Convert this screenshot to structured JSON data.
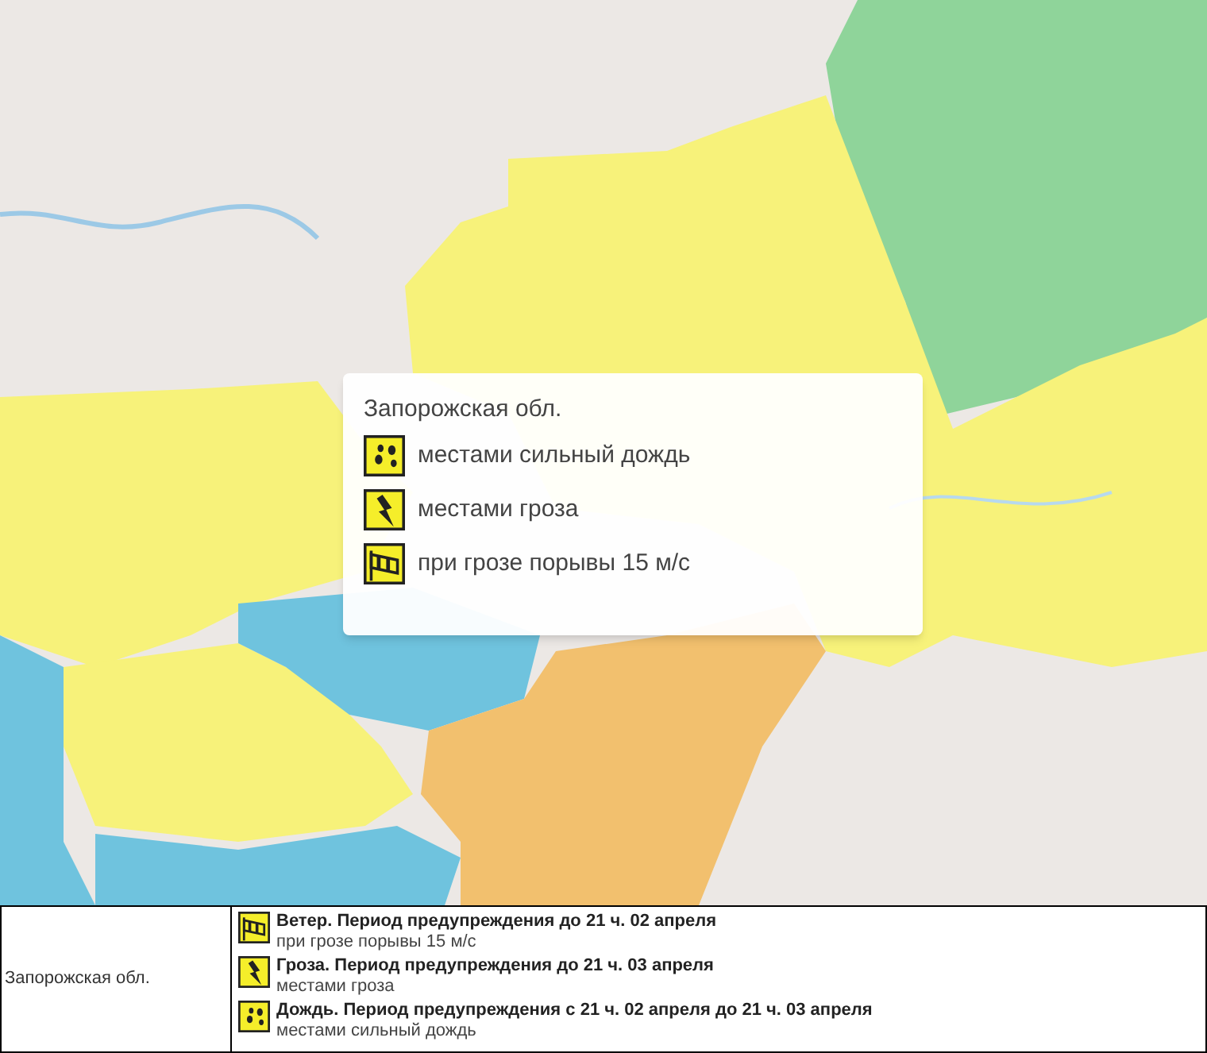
{
  "popup": {
    "title": "Запорожская обл.",
    "warnings": [
      {
        "kind": "rain",
        "text": "местами сильный дождь"
      },
      {
        "kind": "thunder",
        "text": "местами гроза"
      },
      {
        "kind": "wind",
        "text": "при грозе порывы 15 м/с"
      }
    ]
  },
  "table": {
    "region": "Запорожская обл.",
    "warnings": [
      {
        "kind": "wind",
        "title": "Ветер. Период предупреждения до 21 ч. 02 апреля",
        "detail": "при грозе порывы 15 м/с"
      },
      {
        "kind": "thunder",
        "title": "Гроза. Период предупреждения до 21 ч. 03 апреля",
        "detail": "местами гроза"
      },
      {
        "kind": "rain",
        "title": "Дождь. Период предупреждения с 21 ч. 02 апреля до 21 ч. 03 апреля",
        "detail": "местами сильный дождь"
      }
    ]
  }
}
